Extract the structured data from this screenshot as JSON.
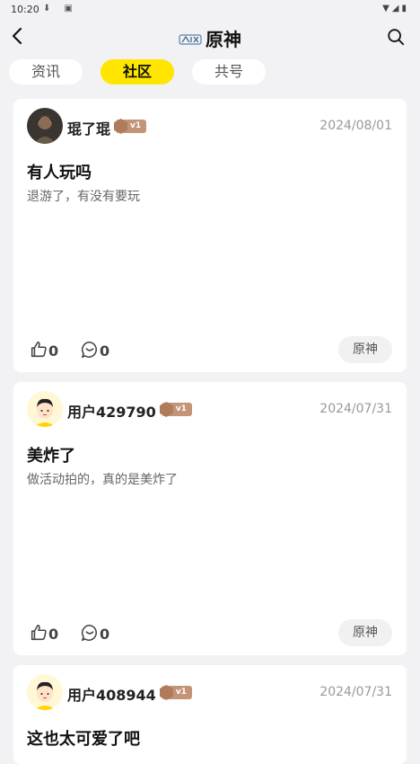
{
  "status_bar": {
    "time": "10:20"
  },
  "header": {
    "title": "原神"
  },
  "tabs": [
    {
      "label": "资讯"
    },
    {
      "label": "社区"
    },
    {
      "label": "共号"
    }
  ],
  "posts": [
    {
      "username": "琨了琨",
      "level": "v1",
      "date": "2024/08/01",
      "title": "有人玩吗",
      "body": "退游了，有没有要玩",
      "likes": "0",
      "comments": "0",
      "tag": "原神"
    },
    {
      "username": "用户429790",
      "level": "v1",
      "date": "2024/07/31",
      "title": "美炸了",
      "body": "做活动拍的，真的是美炸了",
      "likes": "0",
      "comments": "0",
      "tag": "原神"
    },
    {
      "username": "用户408944",
      "level": "v1",
      "date": "2024/07/31",
      "title": "这也太可爱了吧"
    }
  ]
}
